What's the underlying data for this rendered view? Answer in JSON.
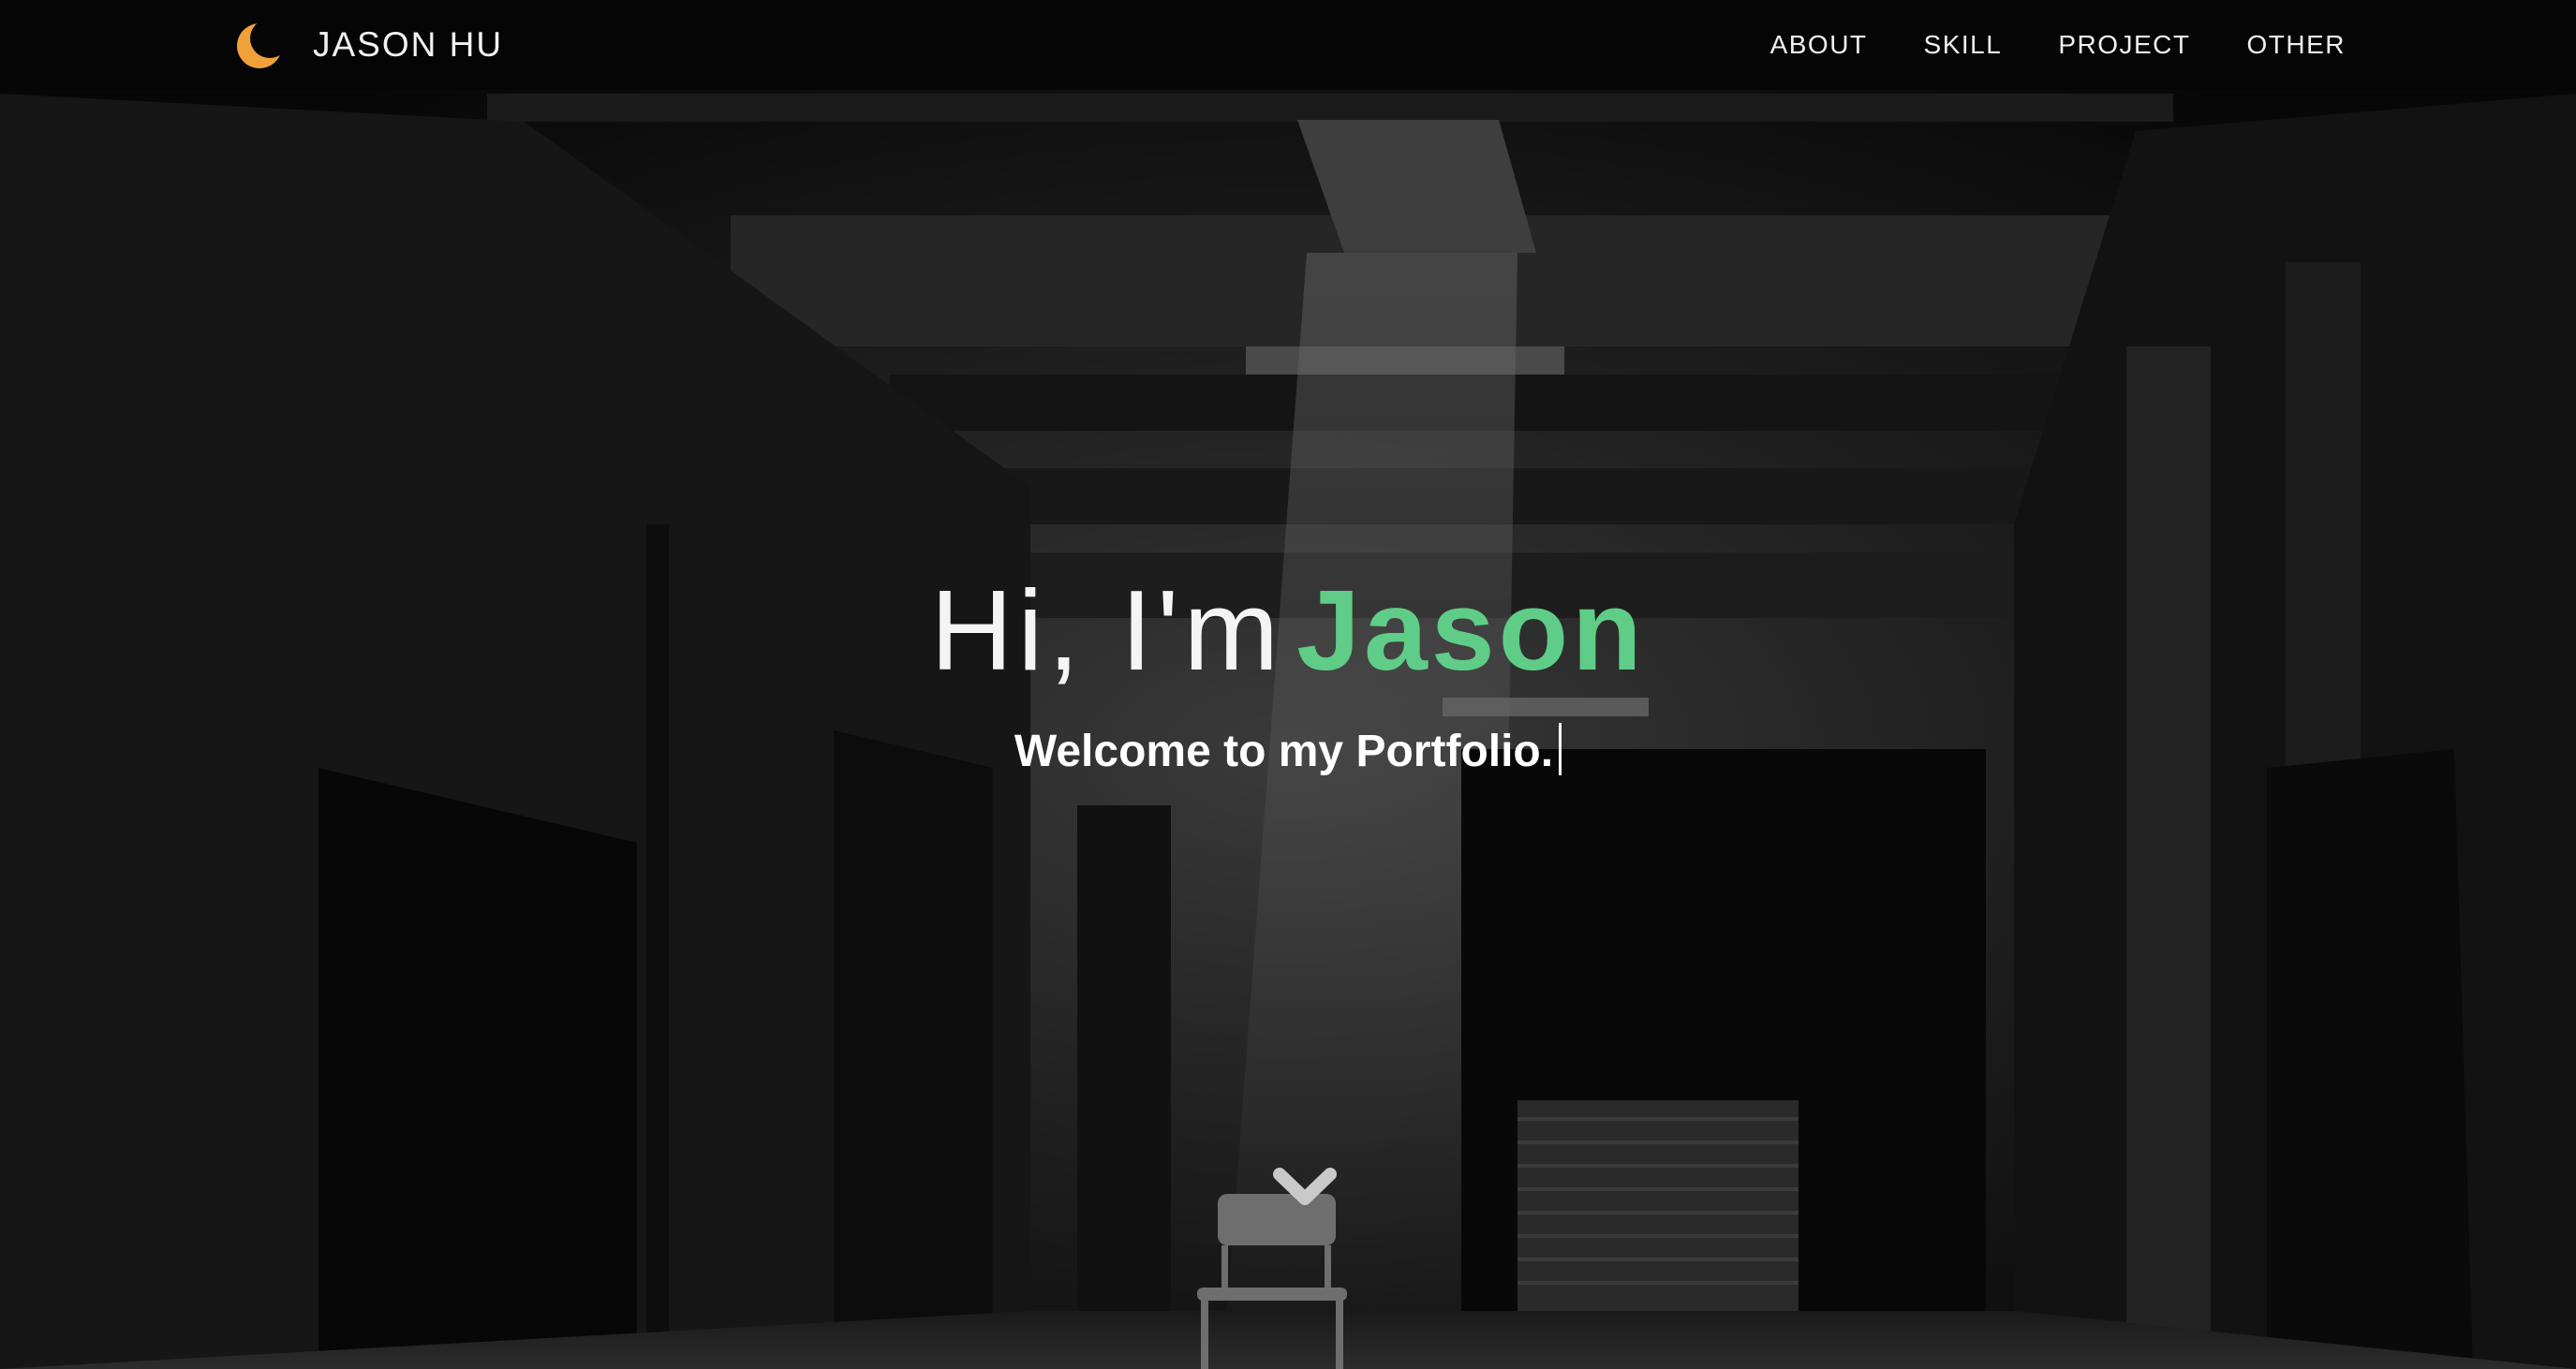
{
  "nav": {
    "brand": "JASON HU",
    "brand_icon": "crescent-moon-icon",
    "links": [
      "ABOUT",
      "SKILL",
      "PROJECT",
      "OTHER"
    ]
  },
  "hero": {
    "greeting": "Hi, I'm",
    "name": "Jason",
    "subtitle": "Welcome to my Portfolio.",
    "scroll_icon": "chevron-down-icon"
  },
  "colors": {
    "accent": "#5fcd87",
    "moon": "#f0a13a",
    "nav_bg": "#050505",
    "text": "#f4f4f4"
  }
}
